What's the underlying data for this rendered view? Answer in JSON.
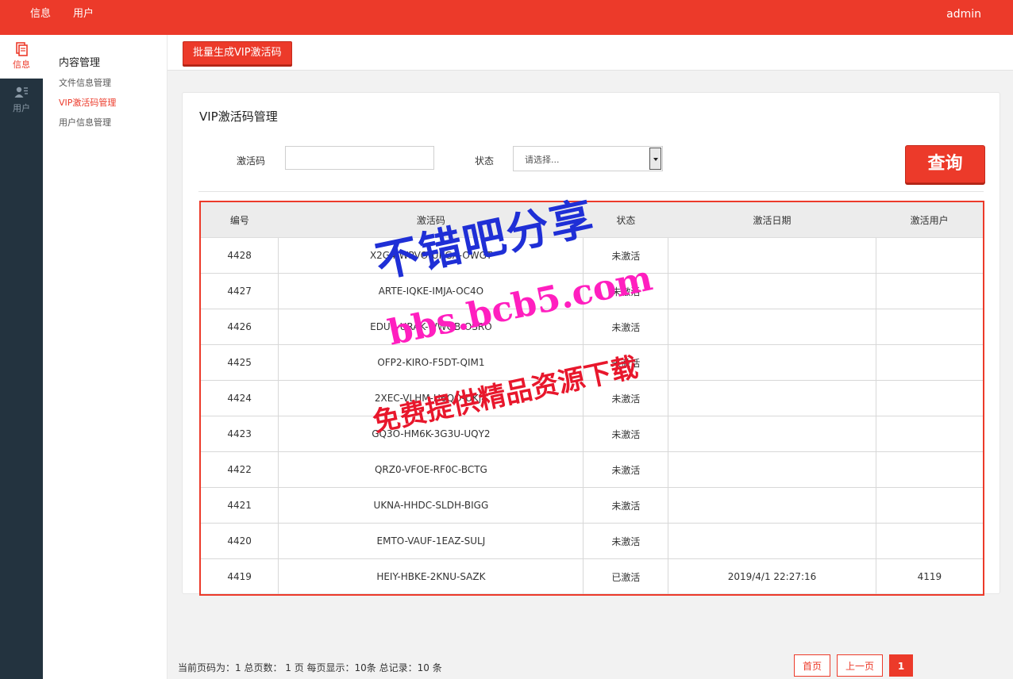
{
  "topbar": {
    "nav": [
      "信息",
      "用户"
    ],
    "user": "admin"
  },
  "rail": {
    "items": [
      {
        "label": "信息",
        "icon": "document-icon"
      },
      {
        "label": "用户",
        "icon": "user-list-icon"
      }
    ]
  },
  "sidebar": {
    "title": "内容管理",
    "links": [
      "文件信息管理",
      "VIP激活码管理",
      "用户信息管理"
    ]
  },
  "toolbar": {
    "generate_label": "批量生成VIP激活码"
  },
  "panel": {
    "title": "VIP激活码管理",
    "code_label": "激活码",
    "code_value": "",
    "status_label": "状态",
    "status_placeholder": "请选择...",
    "query_label": "查询"
  },
  "table": {
    "headers": [
      "编号",
      "激活码",
      "状态",
      "激活日期",
      "激活用户"
    ],
    "rows": [
      [
        "4428",
        "X2G4-WPVO-UKGA-OWGT",
        "未激活",
        "",
        ""
      ],
      [
        "4427",
        "ARTE-IQKE-IMJA-OC4O",
        "未激活",
        "",
        ""
      ],
      [
        "4426",
        "EDUE-URAK-WWGB-OSRO",
        "未激活",
        "",
        ""
      ],
      [
        "4425",
        "OFP2-KIRO-F5DT-QIM1",
        "未激活",
        "",
        ""
      ],
      [
        "4424",
        "2XEC-VLHM-H6QO-UKJ4",
        "未激活",
        "",
        ""
      ],
      [
        "4423",
        "GQ3O-HM6K-3G3U-UQY2",
        "未激活",
        "",
        ""
      ],
      [
        "4422",
        "QRZ0-VFOE-RF0C-BCTG",
        "未激活",
        "",
        ""
      ],
      [
        "4421",
        "UKNA-HHDC-SLDH-BIGG",
        "未激活",
        "",
        ""
      ],
      [
        "4420",
        "EMTO-VAUF-1EAZ-SULJ",
        "未激活",
        "",
        ""
      ],
      [
        "4419",
        "HEIY-HBKE-2KNU-SAZK",
        "已激活",
        "2019/4/1 22:27:16",
        "4119"
      ]
    ]
  },
  "pager": {
    "summary": "当前页码为：1 总页数： 1 页 每页显示：10条 总记录：10 条",
    "first": "首页",
    "prev": "上一页",
    "current": "1"
  },
  "watermark": {
    "line1": "不错吧分享",
    "line2": "bbs.bcb5.com",
    "line3": "免费提供精品资源下载"
  },
  "colors": {
    "accent": "#ec3a2a",
    "rail": "#23333f",
    "watermark_blue": "#1f2fd6",
    "watermark_pink": "#ff1fbf"
  }
}
